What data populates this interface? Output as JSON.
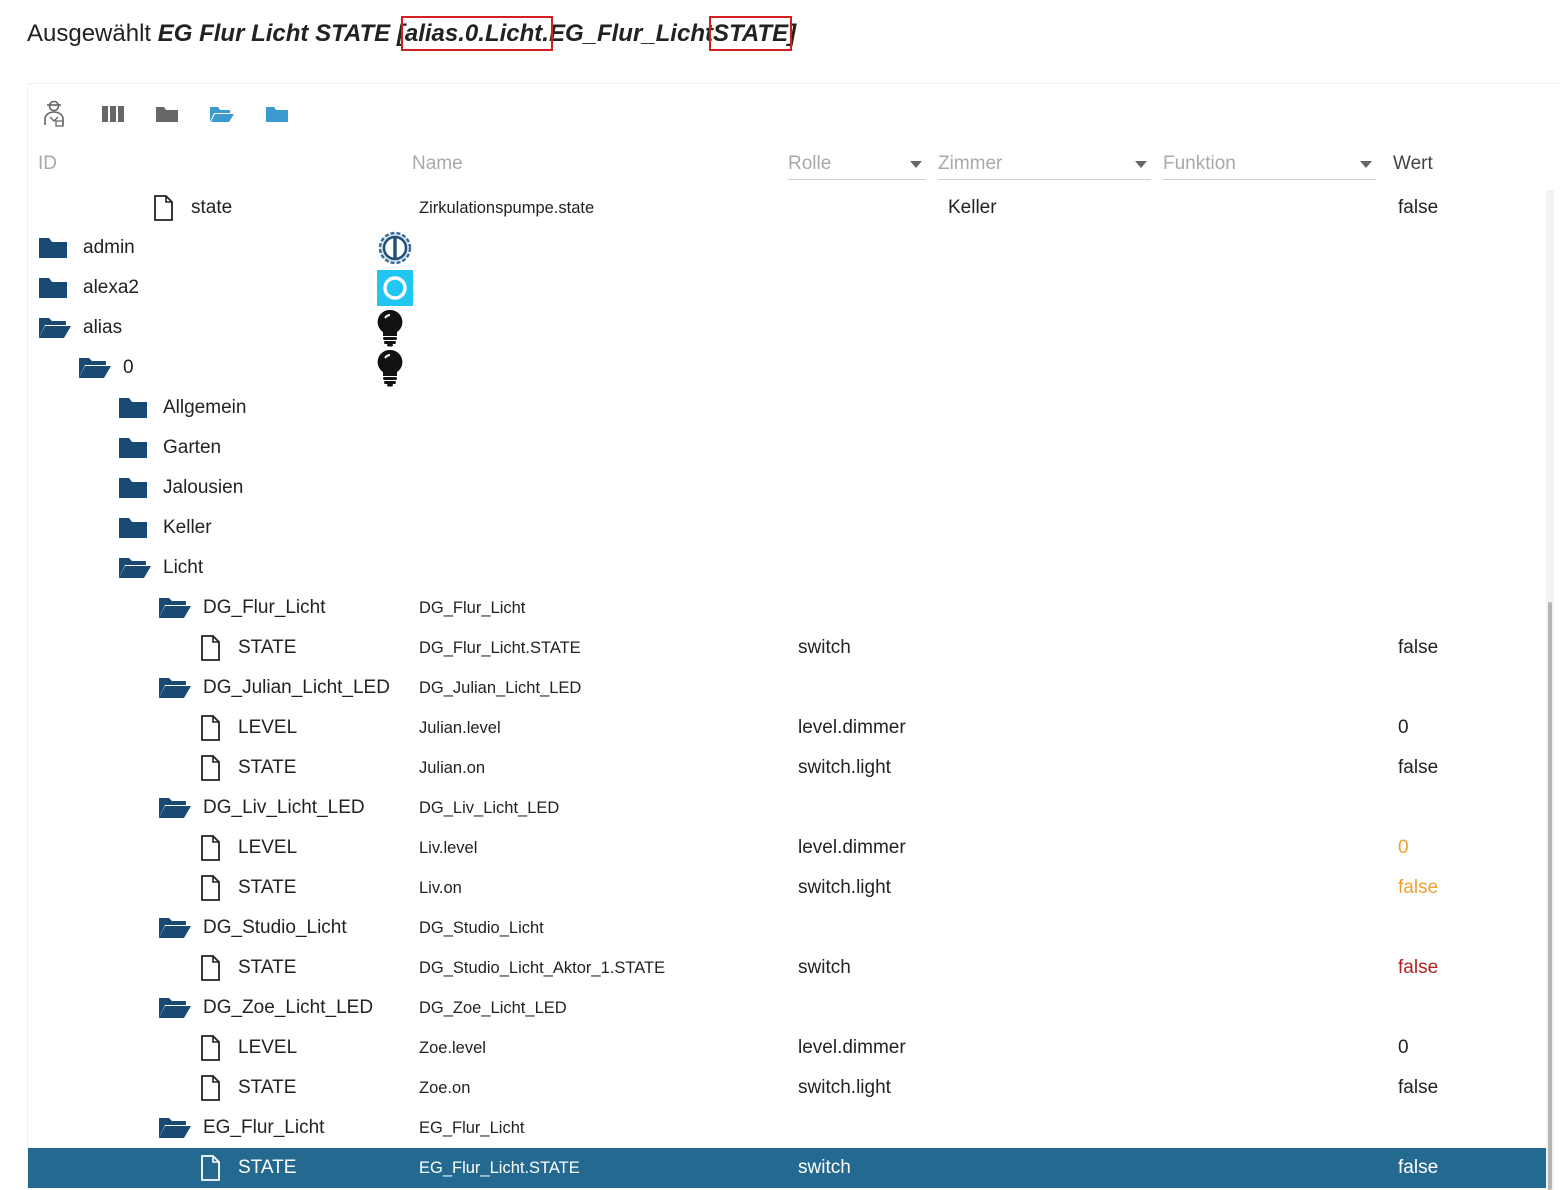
{
  "header": {
    "prefix": "Ausgewählt",
    "selected_name": "EG Flur Licht STATE",
    "id_bracket_open": "[",
    "id_part1": "alias.0.Licht.",
    "id_part2": "EG_Flur_Licht",
    "id_part3": "STATE",
    "id_bracket_close": "]"
  },
  "toolbar": {
    "buttons": [
      {
        "icon": "expert-mode-icon"
      },
      {
        "icon": "columns-icon"
      },
      {
        "icon": "collapse-all-icon"
      },
      {
        "icon": "expand-all-icon"
      },
      {
        "icon": "folder-icon"
      }
    ]
  },
  "columns": {
    "id": "ID",
    "name": "Name",
    "rolle": "Rolle",
    "zimmer": "Zimmer",
    "funktion": "Funktion",
    "wert": "Wert"
  },
  "colors": {
    "folder": "#1a4a73",
    "selected_row": "#24698f",
    "value_orange": "#f0a030",
    "value_red": "#b22222"
  },
  "rows": [
    {
      "type": "file",
      "indent": 3,
      "id": "state",
      "name": "Zirkulationspumpe.state",
      "role": "",
      "room": "Keller",
      "value": "false",
      "value_color": ""
    },
    {
      "type": "folder",
      "indent": 0,
      "open": false,
      "id": "admin",
      "name": "",
      "role": "",
      "room": "",
      "value": "",
      "value_color": "",
      "badge": "admin-logo-icon"
    },
    {
      "type": "folder",
      "indent": 0,
      "open": false,
      "id": "alexa2",
      "name": "",
      "role": "",
      "room": "",
      "value": "",
      "value_color": "",
      "badge": "alexa-logo-icon"
    },
    {
      "type": "folder",
      "indent": 0,
      "open": true,
      "id": "alias",
      "name": "",
      "role": "",
      "room": "",
      "value": "",
      "value_color": "",
      "badge": "lightbulb-icon"
    },
    {
      "type": "folder",
      "indent": 1,
      "open": true,
      "id": "0",
      "name": "",
      "role": "",
      "room": "",
      "value": "",
      "value_color": "",
      "badge": "lightbulb-icon"
    },
    {
      "type": "folder",
      "indent": 2,
      "open": false,
      "id": "Allgemein",
      "name": "",
      "role": "",
      "room": "",
      "value": "",
      "value_color": ""
    },
    {
      "type": "folder",
      "indent": 2,
      "open": false,
      "id": "Garten",
      "name": "",
      "role": "",
      "room": "",
      "value": "",
      "value_color": ""
    },
    {
      "type": "folder",
      "indent": 2,
      "open": false,
      "id": "Jalousien",
      "name": "",
      "role": "",
      "room": "",
      "value": "",
      "value_color": ""
    },
    {
      "type": "folder",
      "indent": 2,
      "open": false,
      "id": "Keller",
      "name": "",
      "role": "",
      "room": "",
      "value": "",
      "value_color": ""
    },
    {
      "type": "folder",
      "indent": 2,
      "open": true,
      "id": "Licht",
      "name": "",
      "role": "",
      "room": "",
      "value": "",
      "value_color": ""
    },
    {
      "type": "folder",
      "indent": 3,
      "open": true,
      "id": "DG_Flur_Licht",
      "name": "DG_Flur_Licht",
      "role": "",
      "room": "",
      "value": "",
      "value_color": ""
    },
    {
      "type": "file",
      "indent": 4,
      "id": "STATE",
      "name": "DG_Flur_Licht.STATE",
      "role": "switch",
      "room": "",
      "value": "false",
      "value_color": ""
    },
    {
      "type": "folder",
      "indent": 3,
      "open": true,
      "id": "DG_Julian_Licht_LED",
      "name": "DG_Julian_Licht_LED",
      "role": "",
      "room": "",
      "value": "",
      "value_color": ""
    },
    {
      "type": "file",
      "indent": 4,
      "id": "LEVEL",
      "name": "Julian.level",
      "role": "level.dimmer",
      "room": "",
      "value": "0",
      "value_color": ""
    },
    {
      "type": "file",
      "indent": 4,
      "id": "STATE",
      "name": "Julian.on",
      "role": "switch.light",
      "room": "",
      "value": "false",
      "value_color": ""
    },
    {
      "type": "folder",
      "indent": 3,
      "open": true,
      "id": "DG_Liv_Licht_LED",
      "name": "DG_Liv_Licht_LED",
      "role": "",
      "room": "",
      "value": "",
      "value_color": ""
    },
    {
      "type": "file",
      "indent": 4,
      "id": "LEVEL",
      "name": "Liv.level",
      "role": "level.dimmer",
      "room": "",
      "value": "0",
      "value_color": "#f0a030"
    },
    {
      "type": "file",
      "indent": 4,
      "id": "STATE",
      "name": "Liv.on",
      "role": "switch.light",
      "room": "",
      "value": "false",
      "value_color": "#f0a030"
    },
    {
      "type": "folder",
      "indent": 3,
      "open": true,
      "id": "DG_Studio_Licht",
      "name": "DG_Studio_Licht",
      "role": "",
      "room": "",
      "value": "",
      "value_color": ""
    },
    {
      "type": "file",
      "indent": 4,
      "id": "STATE",
      "name": "DG_Studio_Licht_Aktor_1.STATE",
      "role": "switch",
      "room": "",
      "value": "false",
      "value_color": "#b22222"
    },
    {
      "type": "folder",
      "indent": 3,
      "open": true,
      "id": "DG_Zoe_Licht_LED",
      "name": "DG_Zoe_Licht_LED",
      "role": "",
      "room": "",
      "value": "",
      "value_color": ""
    },
    {
      "type": "file",
      "indent": 4,
      "id": "LEVEL",
      "name": "Zoe.level",
      "role": "level.dimmer",
      "room": "",
      "value": "0",
      "value_color": ""
    },
    {
      "type": "file",
      "indent": 4,
      "id": "STATE",
      "name": "Zoe.on",
      "role": "switch.light",
      "room": "",
      "value": "false",
      "value_color": ""
    },
    {
      "type": "folder",
      "indent": 3,
      "open": true,
      "id": "EG_Flur_Licht",
      "name": "EG_Flur_Licht",
      "role": "",
      "room": "",
      "value": "",
      "value_color": ""
    },
    {
      "type": "file",
      "indent": 4,
      "id": "STATE",
      "name": "EG_Flur_Licht.STATE",
      "role": "switch",
      "room": "",
      "value": "false",
      "value_color": "",
      "selected": true
    }
  ]
}
